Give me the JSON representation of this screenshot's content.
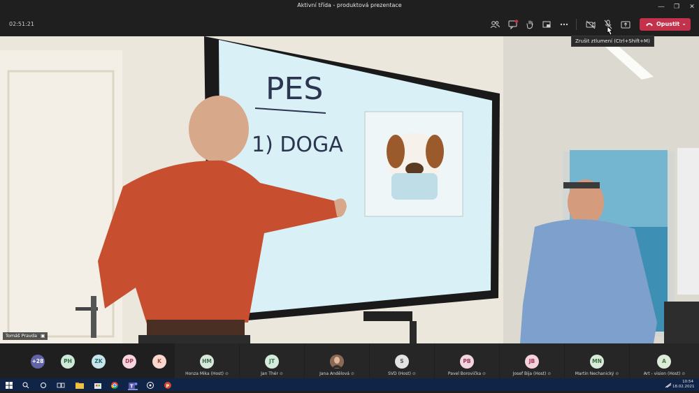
{
  "window": {
    "title": "Aktivní třída - produktová prezentace",
    "minimize": "—",
    "maximize": "❐",
    "close": "✕"
  },
  "toolbar": {
    "timer": "02:51:21",
    "leave_label": "Opustit",
    "tooltip": "Zrušit ztlumení (Ctrl+Shift+M)",
    "icons": [
      "people-icon",
      "chat-icon",
      "raise-hand-icon",
      "breakout-icon",
      "more-icon",
      "camera-icon",
      "mic-muted-icon",
      "share-icon"
    ]
  },
  "video": {
    "speaker_name": "Tomáš Pravda",
    "whiteboard_text": [
      "PES",
      "1) DOGA"
    ]
  },
  "participants": {
    "overflow": {
      "label": "+28",
      "color": "#6264a7"
    },
    "small": [
      {
        "initials": "PH",
        "bg": "#cfe8d8",
        "fg": "#2e6b45"
      },
      {
        "initials": "ZK",
        "bg": "#c8e6ea",
        "fg": "#236a78"
      },
      {
        "initials": "DP",
        "bg": "#f7d6dd",
        "fg": "#a43a52"
      },
      {
        "initials": "K",
        "bg": "#f9d7cf",
        "fg": "#a34a33"
      }
    ],
    "tiles": [
      {
        "initials": "HM",
        "name": "Honza Mika (Host)",
        "bg": "#d9e8dc",
        "fg": "#3f6b4a"
      },
      {
        "initials": "JT",
        "name": "Jan Thér",
        "bg": "#d5ecdc",
        "fg": "#377a4d"
      },
      {
        "initials": "",
        "name": "Jana Andělová",
        "bg": "#8a6a55",
        "fg": "#ffffff",
        "photo": true
      },
      {
        "initials": "S",
        "name": "SVD (Host)",
        "bg": "#e3e3e3",
        "fg": "#555555"
      },
      {
        "initials": "PB",
        "name": "Pavel Borovička",
        "bg": "#f3d5e0",
        "fg": "#9a3a5e"
      },
      {
        "initials": "JB",
        "name": "Josef Bija (Host)",
        "bg": "#f6d3dc",
        "fg": "#a03650"
      },
      {
        "initials": "MN",
        "name": "Martin Nechanický",
        "bg": "#d8ead9",
        "fg": "#3d6e42"
      },
      {
        "initials": "A",
        "name": "Art - vision (Host)",
        "bg": "#dcecd9",
        "fg": "#4a7a3f"
      }
    ]
  },
  "taskbar": {
    "time": "10:54",
    "date": "18.02.2021"
  }
}
